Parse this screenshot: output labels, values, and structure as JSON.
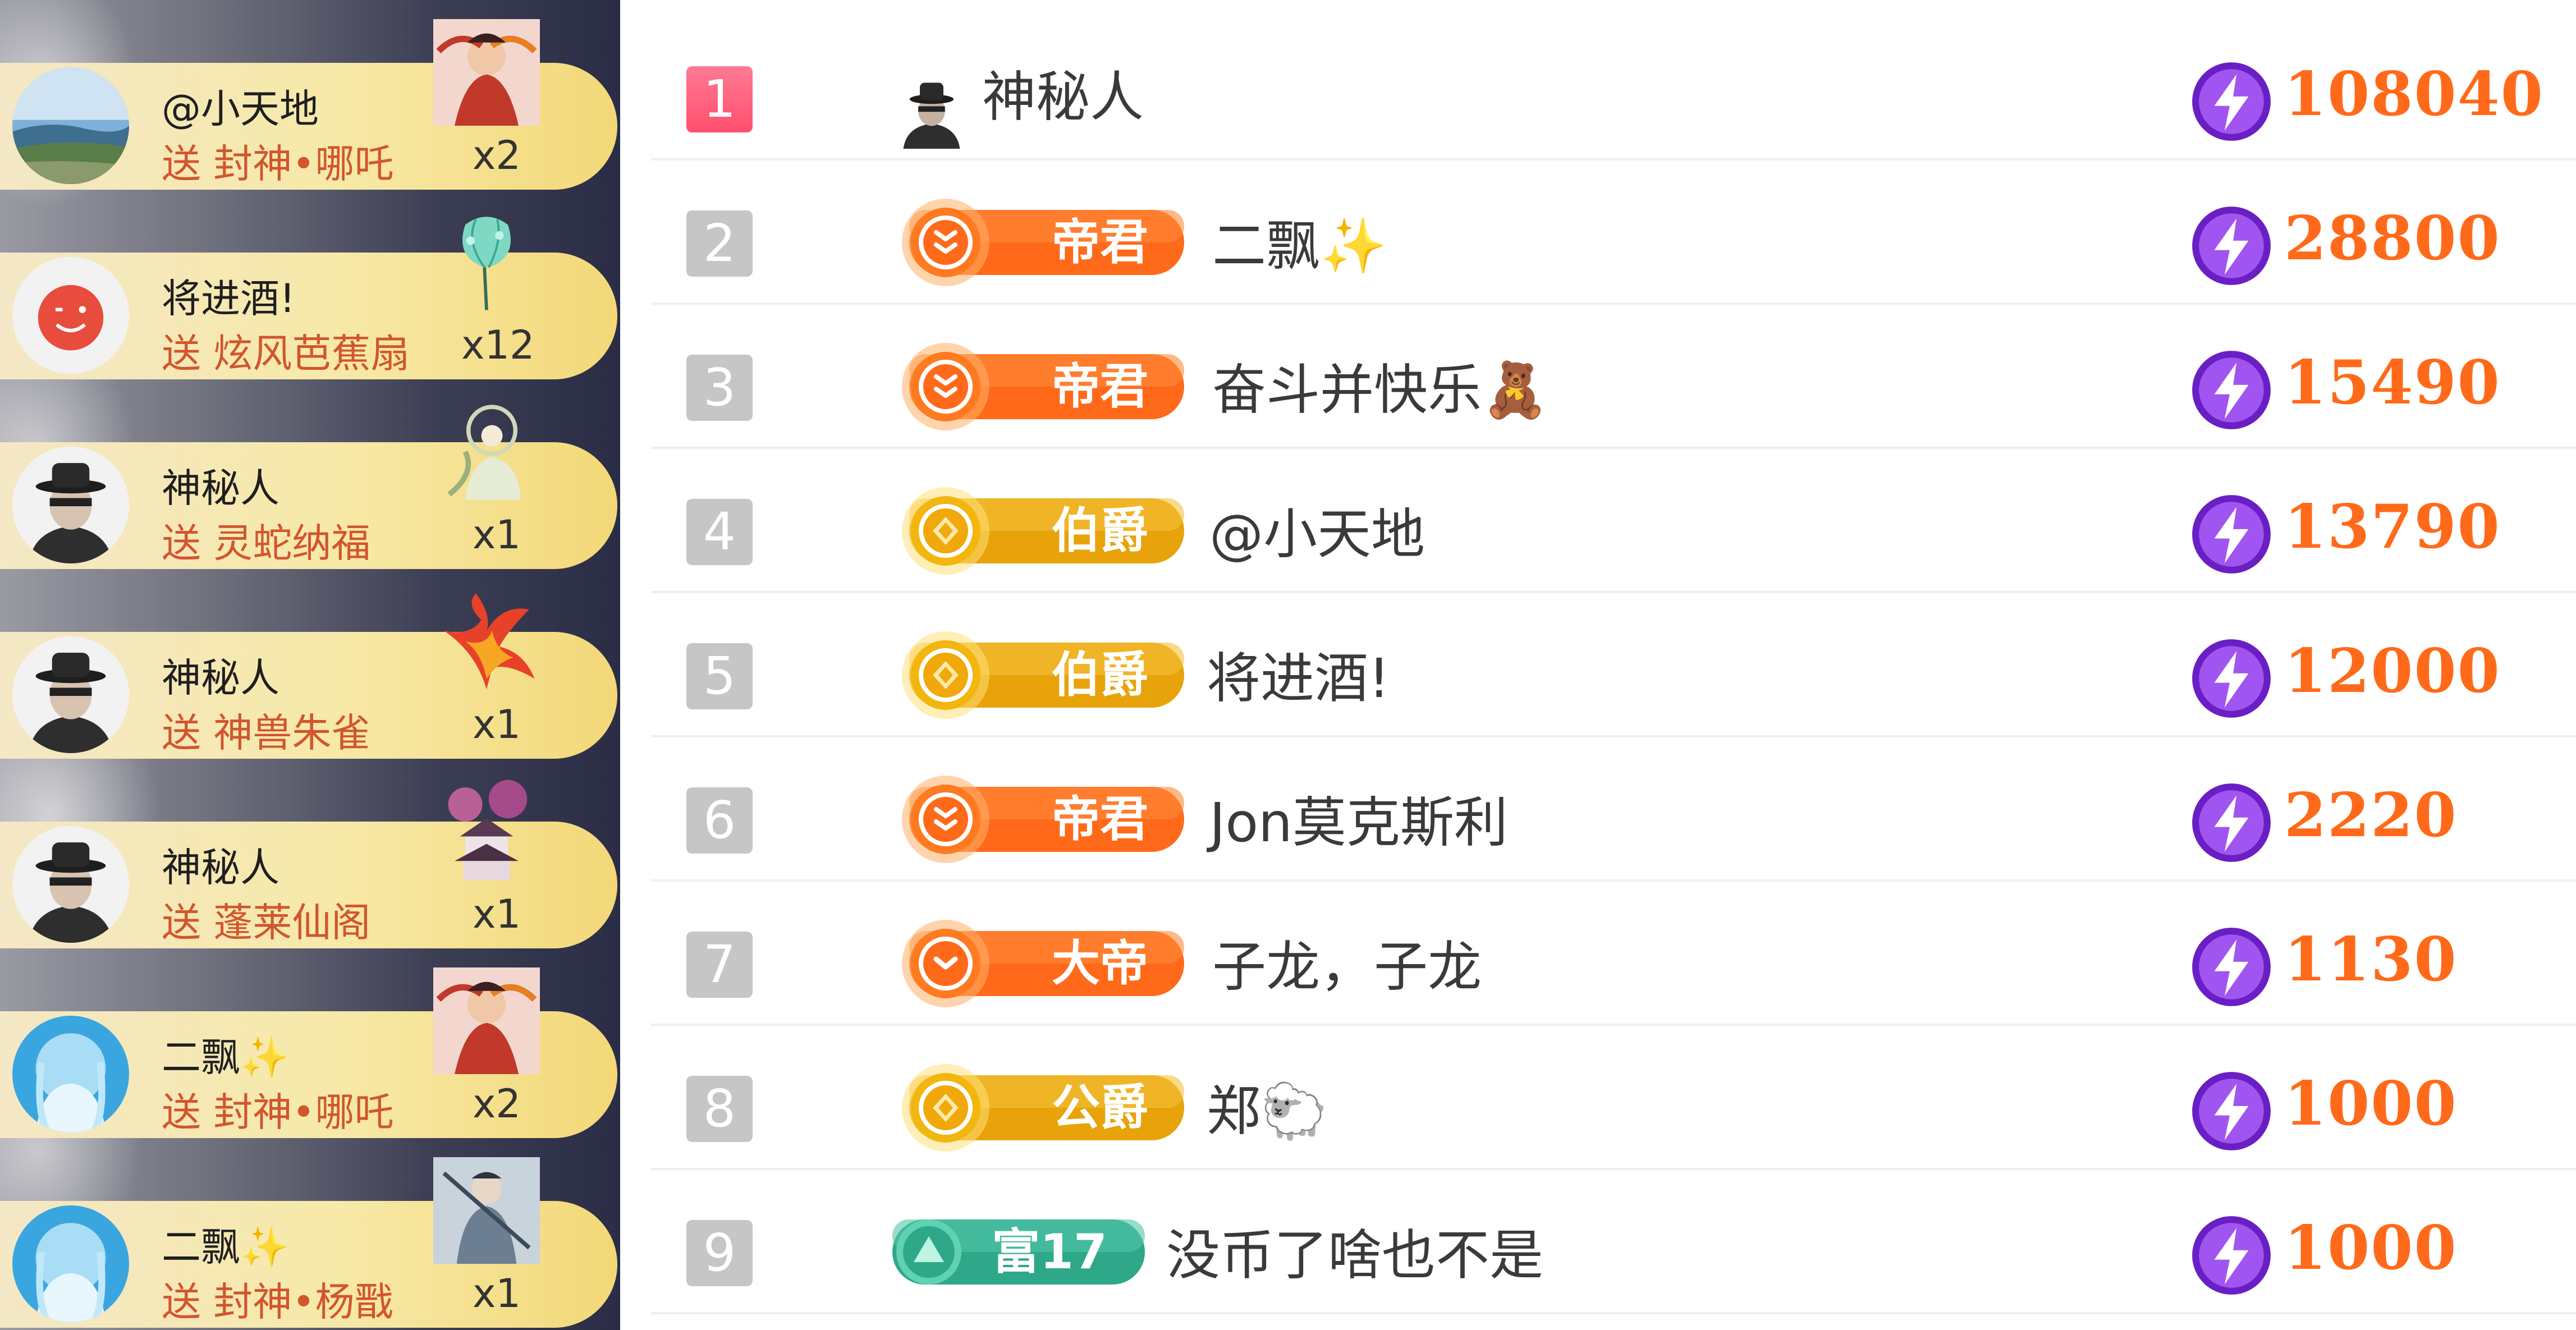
{
  "gift_feed": [
    {
      "user": "@小天地",
      "action": "送",
      "gift": "封神•哪吒",
      "count": "x2",
      "avatar_icon": "seascape-avatar",
      "gift_icon": "nezha-gift-icon"
    },
    {
      "user": "将进酒!",
      "action": "送",
      "gift": "炫风芭蕉扇",
      "count": "x12",
      "avatar_icon": "red-smiley-avatar",
      "gift_icon": "banana-fan-gift-icon"
    },
    {
      "user": "神秘人",
      "action": "送",
      "gift": "灵蛇纳福",
      "count": "x1",
      "avatar_icon": "mystery-man-avatar",
      "gift_icon": "spirit-snake-gift-icon"
    },
    {
      "user": "神秘人",
      "action": "送",
      "gift": "神兽朱雀",
      "count": "x1",
      "avatar_icon": "mystery-man-avatar",
      "gift_icon": "phoenix-gift-icon"
    },
    {
      "user": "神秘人",
      "action": "送",
      "gift": "蓬莱仙阁",
      "count": "x1",
      "avatar_icon": "mystery-man-avatar",
      "gift_icon": "pavilion-gift-icon"
    },
    {
      "user": "二飘",
      "user_suffix": "✨",
      "action": "送",
      "gift": "封神•哪吒",
      "count": "x2",
      "avatar_icon": "anime-girl-avatar",
      "gift_icon": "nezha-gift-icon"
    },
    {
      "user": "二飘",
      "user_suffix": "✨",
      "action": "送",
      "gift": "封神•杨戬",
      "count": "x1",
      "avatar_icon": "anime-girl-avatar",
      "gift_icon": "yangjian-gift-icon"
    }
  ],
  "leaderboard": [
    {
      "rank": "1",
      "name": "神秘人",
      "badge": "",
      "score": "108040"
    },
    {
      "rank": "2",
      "name": "二飘✨",
      "badge": "帝君",
      "badge_type": "orange",
      "score": "28800"
    },
    {
      "rank": "3",
      "name": "奋斗并快乐🧸",
      "badge": "帝君",
      "badge_type": "orange",
      "score": "15490"
    },
    {
      "rank": "4",
      "name": "@小天地",
      "badge": "伯爵",
      "badge_type": "gold",
      "score": "13790"
    },
    {
      "rank": "5",
      "name": "将进酒!",
      "badge": "伯爵",
      "badge_type": "gold",
      "score": "12000"
    },
    {
      "rank": "6",
      "name": "Jon莫克斯利",
      "badge": "帝君",
      "badge_type": "orange",
      "score": "2220"
    },
    {
      "rank": "7",
      "name": "子龙，子龙",
      "badge": "大帝",
      "badge_type": "orange",
      "score": "1130"
    },
    {
      "rank": "8",
      "name": "郑🐑",
      "badge": "公爵",
      "badge_type": "gold",
      "score": "1000"
    },
    {
      "rank": "9",
      "name": "没币了啥也不是",
      "badge": "富17",
      "badge_type": "teal",
      "score": "1000"
    }
  ],
  "colors": {
    "score": "#ff6a1a",
    "gift_action": "#d2552d",
    "rank_first": "#ff4f6e",
    "rank_other": "#c6c6c6",
    "coin": "#8b2fe0"
  }
}
